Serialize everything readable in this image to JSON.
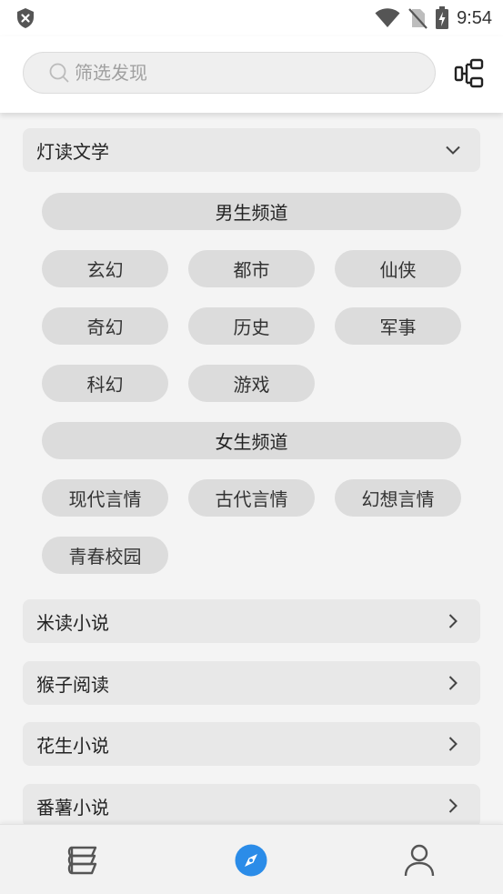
{
  "status_bar": {
    "time": "9:54"
  },
  "search": {
    "placeholder": "筛选发现"
  },
  "sections": [
    {
      "title": "灯读文学",
      "expanded": true,
      "channels": [
        {
          "name": "男生频道",
          "tags": [
            "玄幻",
            "都市",
            "仙侠",
            "奇幻",
            "历史",
            "军事",
            "科幻",
            "游戏"
          ]
        },
        {
          "name": "女生频道",
          "tags": [
            "现代言情",
            "古代言情",
            "幻想言情",
            "青春校园"
          ]
        }
      ]
    },
    {
      "title": "米读小说",
      "expanded": false
    },
    {
      "title": "猴子阅读",
      "expanded": false
    },
    {
      "title": "花生小说",
      "expanded": false
    },
    {
      "title": "番薯小说",
      "expanded": false
    }
  ],
  "bottom_nav": [
    {
      "icon": "bookshelf-icon",
      "active": false
    },
    {
      "icon": "compass-icon",
      "active": true
    },
    {
      "icon": "person-icon",
      "active": false
    }
  ],
  "colors": {
    "accent": "#2b8ce8",
    "icon_gray": "#555555"
  }
}
